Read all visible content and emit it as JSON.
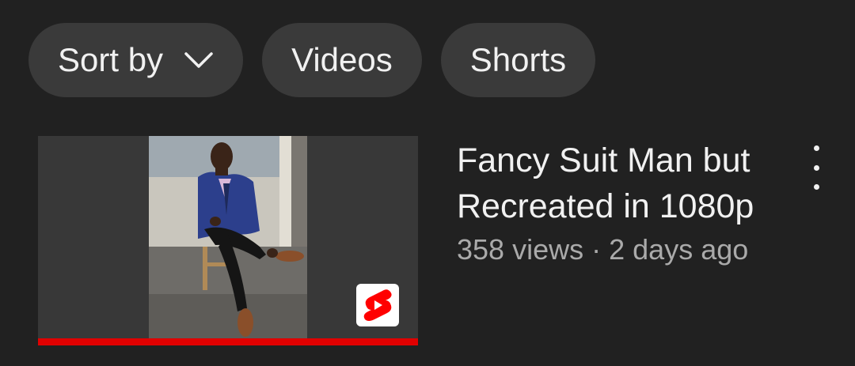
{
  "filters": {
    "sort_label": "Sort by",
    "videos_label": "Videos",
    "shorts_label": "Shorts"
  },
  "video": {
    "title": "Fancy Suit Man but Recreated in 1080p",
    "views": "358 views",
    "separator": "·",
    "age": "2 days ago",
    "watch_progress": 1.0
  },
  "icons": {
    "sort_chevron": "chevron-down-icon",
    "shorts_badge": "shorts-logo-icon",
    "more": "more-vert-icon"
  },
  "colors": {
    "background": "#212121",
    "chip": "#3a3a3a",
    "progress": "#e00000",
    "shorts_red": "#ff0000"
  }
}
